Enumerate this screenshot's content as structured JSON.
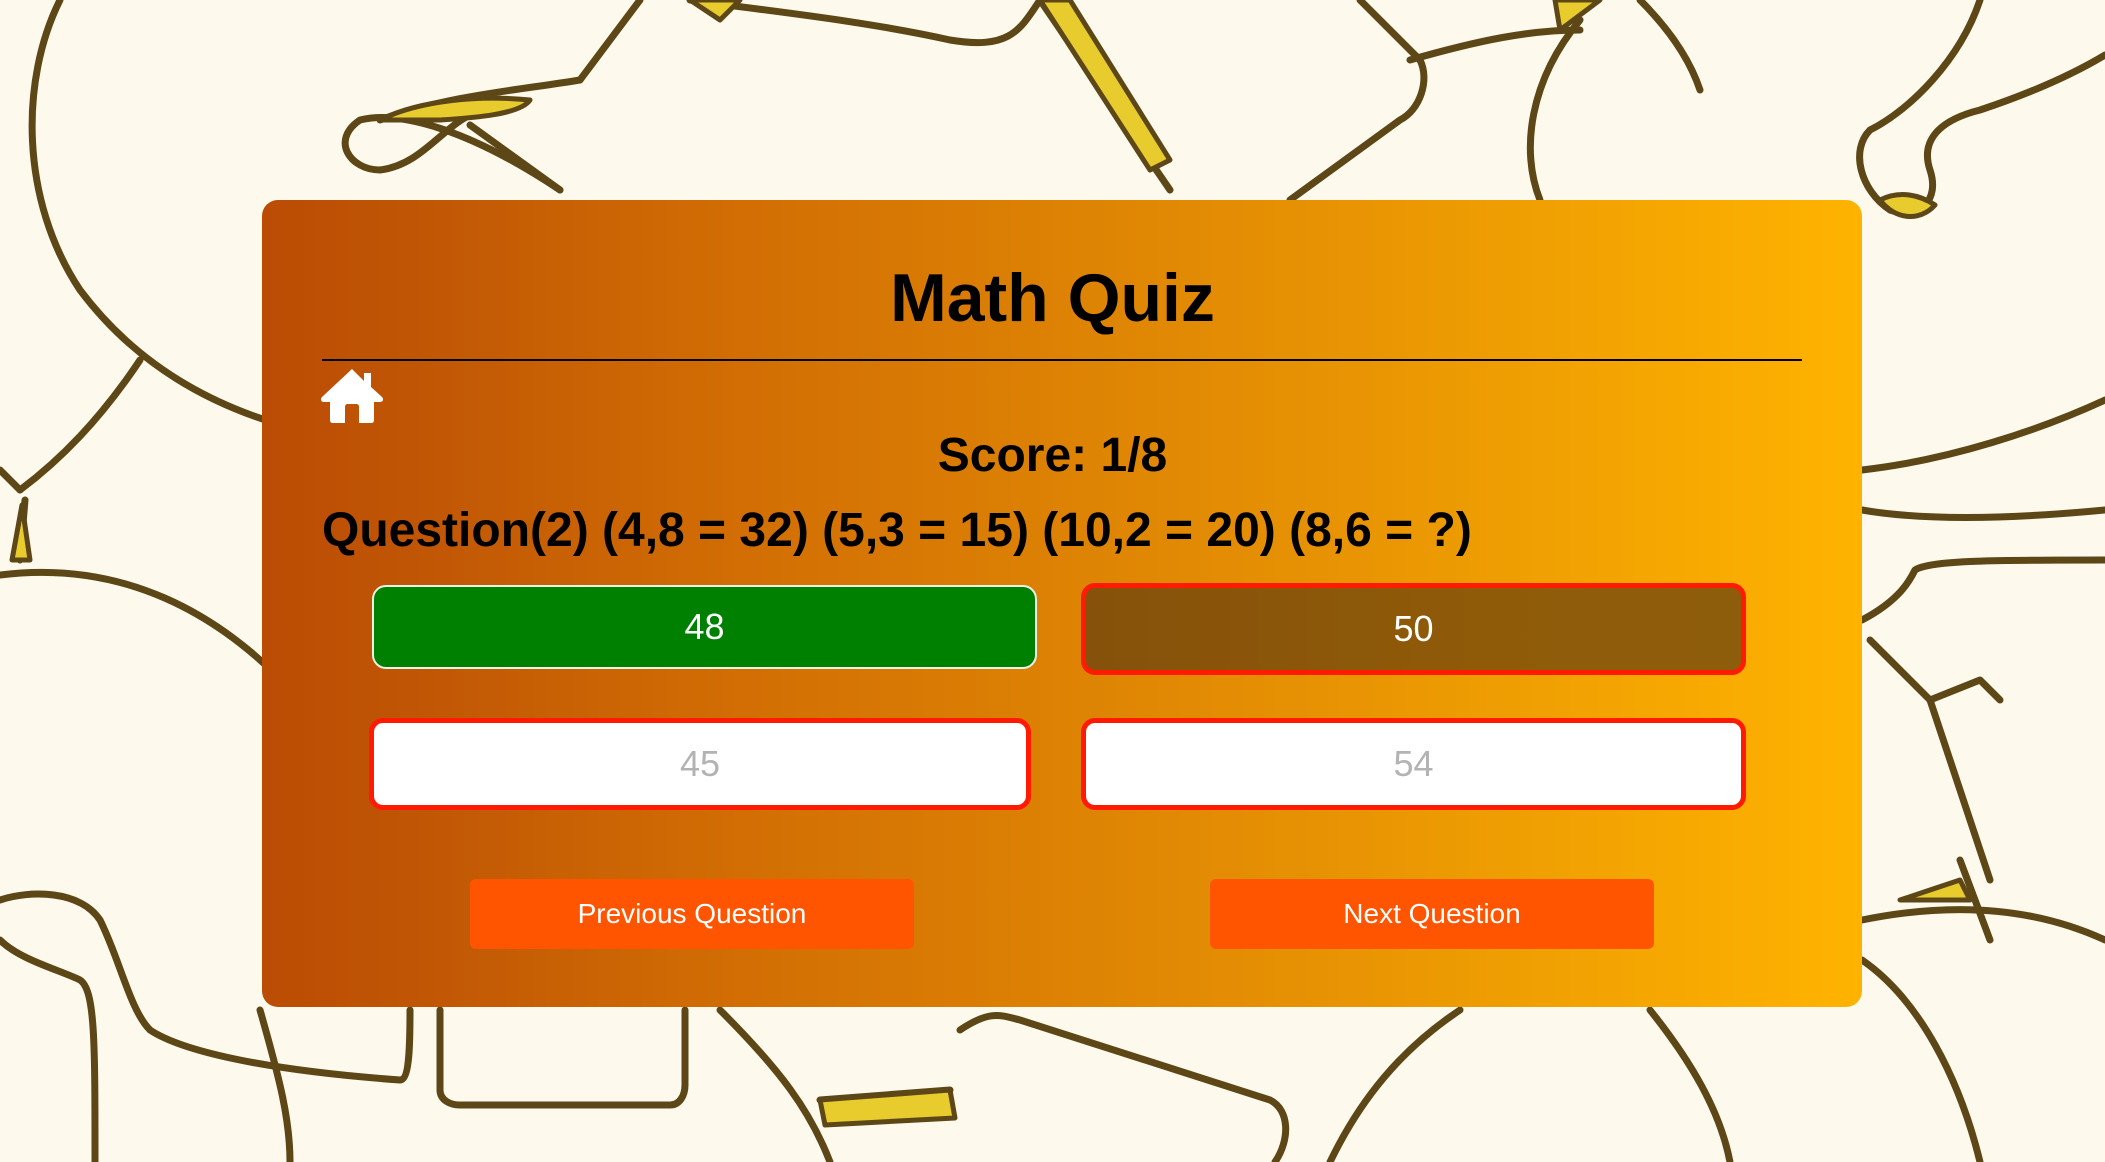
{
  "app": {
    "title": "Math Quiz"
  },
  "header": {
    "home_icon": "home-icon"
  },
  "quiz": {
    "score_text": "Score: 1/8",
    "question_text": "Question(2) (4,8 = 32) (5,3 = 15) (10,2 = 20) (8,6 = ?)",
    "options": [
      {
        "label": "48",
        "state": "correct"
      },
      {
        "label": "50",
        "state": "selected-wrong"
      },
      {
        "label": "45",
        "state": "wrong"
      },
      {
        "label": "54",
        "state": "wrong"
      }
    ]
  },
  "navigation": {
    "previous_label": "Previous Question",
    "next_label": "Next Question"
  },
  "colors": {
    "page_background": "#fdf9ec",
    "card_gradient_start": "#bb4c04",
    "card_gradient_end": "#ffb300",
    "correct_green": "#008000",
    "wrong_border_red": "#ff1a00",
    "nav_button_orange": "#ff5500",
    "doodle_stroke": "#5e4716",
    "doodle_fill": "#e8cc2e"
  }
}
